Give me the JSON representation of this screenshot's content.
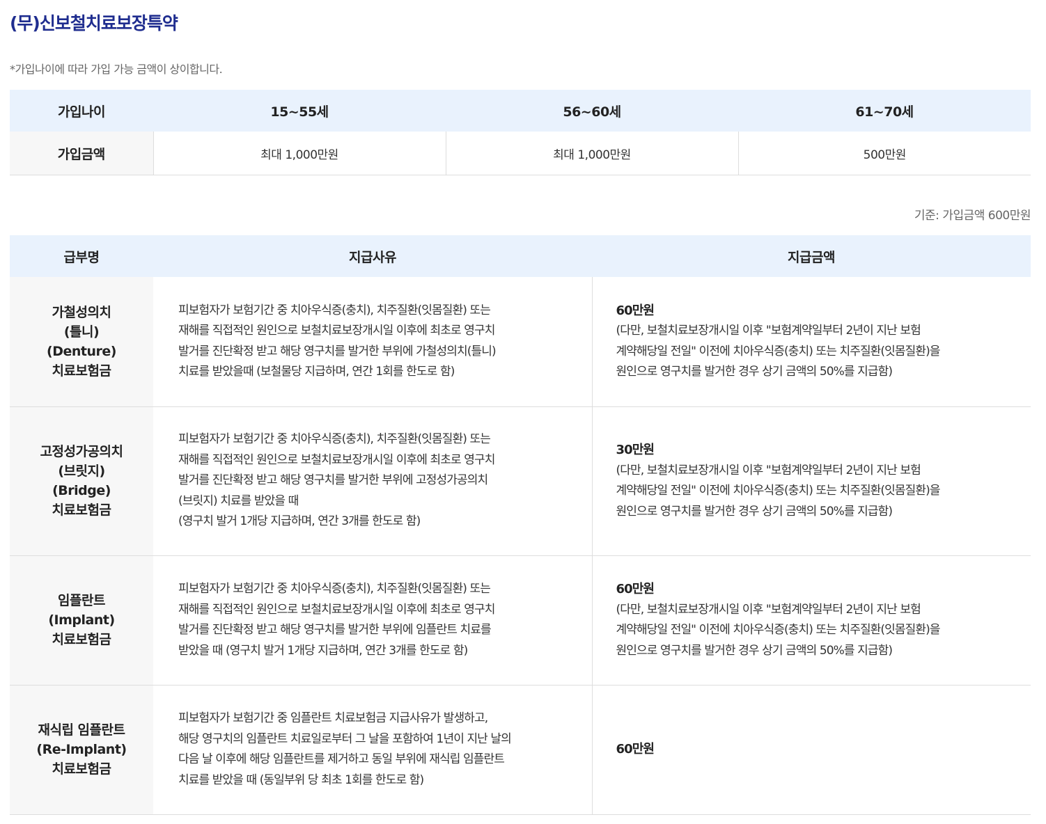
{
  "title": "(무)신보철치료보장특약",
  "note": "*가입나이에 따라 가입 가능 금액이 상이합니다.",
  "age_table": {
    "header_label": "가입나이",
    "ages": [
      "15~55세",
      "56~60세",
      "61~70세"
    ],
    "row_label": "가입금액",
    "amounts": [
      "최대 1,000만원",
      "최대 1,000만원",
      "500만원"
    ]
  },
  "basis": "기준: 가입금액 600만원",
  "benefit_table": {
    "headers": {
      "name": "급부명",
      "reason": "지급사유",
      "amount": "지급금액"
    },
    "rows": [
      {
        "name_lines": [
          "가철성의치",
          "(틀니)",
          "(Denture)",
          "치료보험금"
        ],
        "reason_lines": [
          "피보험자가 보험기간 중 치아우식증(충치), 치주질환(잇몸질환) 또는",
          "재해를 직접적인 원인으로 보철치료보장개시일 이후에 최초로 영구치",
          "발거를 진단확정 받고 해당 영구치를 발거한 부위에 가철성의치(틀니)",
          "치료를 받았을때 (보철물당 지급하며, 연간 1회를 한도로 함)"
        ],
        "amount": "60만원",
        "amount_note_lines": [
          "(다만, 보철치료보장개시일 이후 \"보험계약일부터 2년이 지난 보험",
          "계약해당일 전일\" 이전에 치아우식증(충치) 또는 치주질환(잇몸질환)을",
          "원인으로 영구치를 발거한 경우 상기 금액의 50%를 지급함)"
        ]
      },
      {
        "name_lines": [
          "고정성가공의치",
          "(브릿지)",
          "(Bridge)",
          "치료보험금"
        ],
        "reason_lines": [
          "피보험자가 보험기간 중 치아우식증(충치), 치주질환(잇몸질환) 또는",
          "재해를 직접적인 원인으로 보철치료보장개시일 이후에 최초로 영구치",
          "발거를 진단확정 받고 해당 영구치를 발거한 부위에 고정성가공의치",
          "(브릿지) 치료를 받았을 때",
          "(영구치 발거 1개당 지급하며, 연간 3개를 한도로 함)"
        ],
        "amount": "30만원",
        "amount_note_lines": [
          "(다만, 보철치료보장개시일 이후 \"보험계약일부터 2년이 지난 보험",
          "계약해당일 전일\" 이전에 치아우식증(충치) 또는 치주질환(잇몸질환)을",
          "원인으로 영구치를 발거한 경우 상기 금액의 50%를 지급함)"
        ]
      },
      {
        "name_lines": [
          "임플란트",
          "(Implant)",
          "치료보험금"
        ],
        "reason_lines": [
          "피보험자가 보험기간 중 치아우식증(충치), 치주질환(잇몸질환) 또는",
          "재해를 직접적인 원인으로 보철치료보장개시일 이후에 최초로 영구치",
          "발거를 진단확정 받고 해당 영구치를 발거한 부위에 임플란트 치료를",
          "받았을 때 (영구치 발거 1개당 지급하며, 연간 3개를 한도로 함)"
        ],
        "amount": "60만원",
        "amount_note_lines": [
          "(다만, 보철치료보장개시일 이후 \"보험계약일부터 2년이 지난 보험",
          "계약해당일 전일\" 이전에 치아우식증(충치) 또는 치주질환(잇몸질환)을",
          "원인으로 영구치를 발거한 경우 상기 금액의 50%를 지급함)"
        ]
      },
      {
        "name_lines": [
          "재식립 임플란트",
          "(Re-Implant)",
          "치료보험금"
        ],
        "reason_lines": [
          "피보험자가 보험기간 중 임플란트 치료보험금 지급사유가 발생하고,",
          "해당 영구치의 임플란트 치료일로부터 그 날을 포함하여 1년이 지난 날의",
          "다음 날 이후에 해당 임플란트를 제거하고 동일 부위에 재식립 임플란트",
          "치료를 받았을 때 (동일부위 당 최초 1회를 한도로 함)"
        ],
        "amount": "60만원",
        "amount_note_lines": []
      }
    ]
  }
}
